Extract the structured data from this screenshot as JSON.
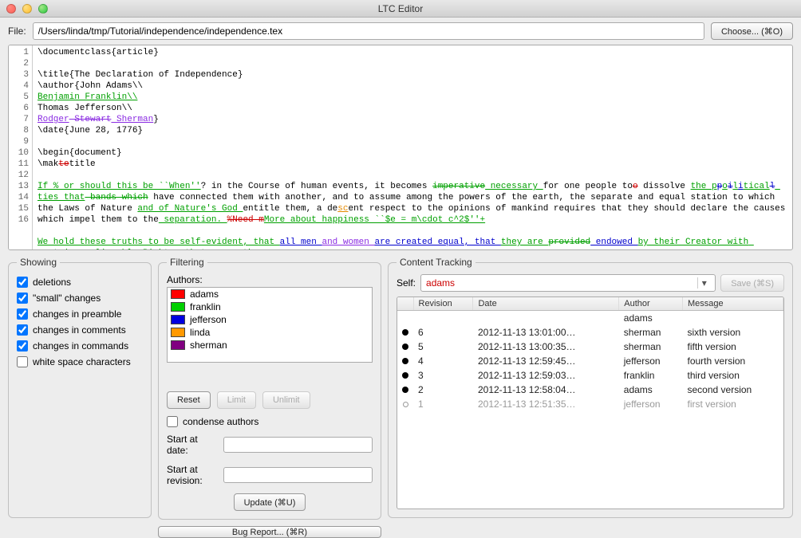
{
  "window_title": "LTC Editor",
  "file_label": "File:",
  "file_path": "/Users/linda/tmp/Tutorial/independence/independence.tex",
  "choose_button": "Choose... (⌘O)",
  "line_numbers": [
    "1",
    "2",
    "3",
    "4",
    "5",
    "6",
    "7",
    "8",
    "9",
    "10",
    "11",
    "12",
    "13",
    "",
    "",
    "",
    "14",
    "15",
    "",
    "16"
  ],
  "code_plain_parts": {
    "l1": "\\documentclass{article}",
    "l3": "\\title{The Declaration of Independence}",
    "l4": "\\author{John Adams\\\\",
    "l5": "Benjamin Franklin\\\\",
    "l6": "Thomas Jefferson\\\\",
    "l7a": "Rodger",
    "l7b": " Stewart",
    "l7c": " Sherman",
    "l7d": "}",
    "l8": "\\date{June 28, 1776}",
    "l10": "\\begin{document}",
    "l11a": "\\mak",
    "l11b": "te",
    "l11c": "title",
    "l13a": "If % or should this be ``When''",
    "l13b": "? in the Course of human events, it becomes ",
    "l13c": "imperative",
    "l13d": " necessary ",
    "l13e": "for one people to",
    "l13f": "o",
    "l13g": " dissolve ",
    "l13h": "the p",
    "l13i": "p",
    "l13j": "o",
    "l13k": "i",
    "l13l": "l",
    "l13m": "i",
    "l13n": "tical",
    "l13o": "l",
    "l13p": " ties that",
    "l13q": " bands which",
    "l13r": " have connected them with another, and to assume among the powers of the earth, the separate and equal station to which the Laws of Nature ",
    "l13s": "and of Nature's God ",
    "l13t": "entitle them, a de",
    "l13u": "sc",
    "l13v": "ent respect to the opinions of mankind requires that they should declare the causes which impel them to the",
    "l13w": " separation. ",
    "l13x": "%Need m",
    "l13y": "More about happiness ``$e = m\\cdot c^2$''+",
    "l15a": "We hold these truths to be self-evident, that ",
    "l15b": "all men ",
    "l15c": "and women ",
    "l15d": "are created equal, that ",
    "l15e": "they are ",
    "l15f": "provided",
    "l15g": " endowed ",
    "l15h": "by their Creator with certain unalienable Rights, that among these are",
    "l15i": "."
  },
  "showing": {
    "legend": "Showing",
    "items": [
      {
        "label": "deletions",
        "checked": true
      },
      {
        "label": "\"small\" changes",
        "checked": true
      },
      {
        "label": "changes in preamble",
        "checked": true
      },
      {
        "label": "changes in comments",
        "checked": true
      },
      {
        "label": "changes in commands",
        "checked": true
      },
      {
        "label": "white space characters",
        "checked": false
      }
    ]
  },
  "filtering": {
    "legend": "Filtering",
    "authors_label": "Authors:",
    "authors": [
      {
        "name": "adams",
        "color": "#ff0000"
      },
      {
        "name": "franklin",
        "color": "#00d000"
      },
      {
        "name": "jefferson",
        "color": "#0000e0"
      },
      {
        "name": "linda",
        "color": "#ff9900"
      },
      {
        "name": "sherman",
        "color": "#800080"
      }
    ],
    "reset": "Reset",
    "limit": "Limit",
    "unlimit": "Unlimit",
    "condense": "condense authors",
    "start_date_label": "Start at date:",
    "start_date_value": "",
    "start_rev_label": "Start at revision:",
    "start_rev_value": "",
    "update": "Update (⌘U)",
    "bug": "Bug Report... (⌘R)"
  },
  "tracking": {
    "legend": "Content Tracking",
    "self_label": "Self:",
    "self_value": "adams",
    "save": "Save (⌘S)",
    "save_disabled": true,
    "columns": [
      "",
      "Revision",
      "Date",
      "Author",
      "Message"
    ],
    "rows": [
      {
        "dot": "none",
        "rev": "",
        "date": "",
        "author": "adams",
        "message": ""
      },
      {
        "dot": "solid",
        "rev": "6",
        "date": "2012-11-13 13:01:00…",
        "author": "sherman",
        "message": "sixth version"
      },
      {
        "dot": "solid",
        "rev": "5",
        "date": "2012-11-13 13:00:35…",
        "author": "sherman",
        "message": "fifth version"
      },
      {
        "dot": "solid",
        "rev": "4",
        "date": "2012-11-13 12:59:45…",
        "author": "jefferson",
        "message": "fourth version"
      },
      {
        "dot": "solid",
        "rev": "3",
        "date": "2012-11-13 12:59:03…",
        "author": "franklin",
        "message": "third version"
      },
      {
        "dot": "solid",
        "rev": "2",
        "date": "2012-11-13 12:58:04…",
        "author": "adams",
        "message": "second version"
      },
      {
        "dot": "open",
        "rev": "1",
        "date": "2012-11-13 12:51:35…",
        "author": "jefferson",
        "message": "first version",
        "dim": true
      }
    ]
  }
}
